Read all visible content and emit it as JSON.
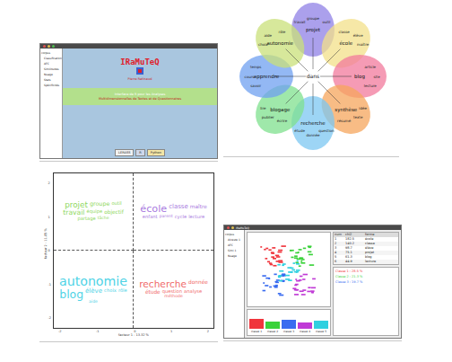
{
  "app_window": {
    "title": "IRaMuTeQ",
    "credit": "Pierre Ratinaud",
    "band_lines": [
      "Interface de R pour les Analyses",
      "Multidimensionnelles de Textes et de Questionnaires"
    ],
    "tree_items": [
      "corpus",
      "Classification",
      "AFC",
      "Similitudes",
      "Nuage",
      "Stats",
      "Spécificités"
    ],
    "logos": [
      "LERASS",
      "R",
      "Python"
    ]
  },
  "similarity_graph": {
    "hub": "dans",
    "clusters": [
      {
        "label": "projet",
        "color": "#8f80e6",
        "words": [
          "travail",
          "groupe",
          "outil"
        ]
      },
      {
        "label": "école",
        "color": "#f3e08a",
        "words": [
          "classe",
          "élève",
          "maître"
        ]
      },
      {
        "label": "blog",
        "color": "#f27a9c",
        "words": [
          "article",
          "site",
          "lecture"
        ]
      },
      {
        "label": "synthèse",
        "color": "#f6a55c",
        "words": [
          "idée",
          "texte",
          "résumé"
        ]
      },
      {
        "label": "recherche",
        "color": "#7cc7f2",
        "words": [
          "question",
          "donnée",
          "étude"
        ]
      },
      {
        "label": "blogage",
        "color": "#7fe08d",
        "words": [
          "écrire",
          "publier",
          "lire"
        ]
      },
      {
        "label": "apprendre",
        "color": "#6fa0f0",
        "words": [
          "savoir",
          "cours",
          "temps"
        ]
      },
      {
        "label": "autonomie",
        "color": "#c9e07a",
        "words": [
          "choix",
          "aide",
          "rôle"
        ]
      }
    ]
  },
  "factor_map": {
    "x_axis": "facteur 1 - 13.32 %",
    "y_axis": "facteur 2 - 11.05 %",
    "x_ticks": [
      "-2",
      "-1",
      "0",
      "1",
      "2"
    ],
    "y_ticks": [
      "2",
      "1",
      "0",
      "-1",
      "-2"
    ],
    "classes": [
      {
        "color": "#8fd860",
        "words": [
          {
            "text": "projet",
            "level": 0.4
          },
          {
            "text": "groupe",
            "level": 0.2
          },
          {
            "text": "outil",
            "level": 0.1
          },
          {
            "text": "travail",
            "level": 0.3
          },
          {
            "text": "équipe",
            "level": 0.1
          },
          {
            "text": "objectif",
            "level": 0.15
          },
          {
            "text": "partage",
            "level": 0.1
          },
          {
            "text": "tâche",
            "level": 0.05
          }
        ]
      },
      {
        "color": "#a97be0",
        "words": [
          {
            "text": "école",
            "level": 0.6
          },
          {
            "text": "classe",
            "level": 0.25
          },
          {
            "text": "maître",
            "level": 0.15
          },
          {
            "text": "enfant",
            "level": 0.1
          },
          {
            "text": "parent",
            "level": 0.05
          },
          {
            "text": "cycle",
            "level": 0.1
          },
          {
            "text": "lecture",
            "level": 0.1
          }
        ]
      },
      {
        "color": "#4fd3e6",
        "words": [
          {
            "text": "autonomie",
            "level": 0.85
          },
          {
            "text": "blog",
            "level": 0.7
          },
          {
            "text": "élève",
            "level": 0.25
          },
          {
            "text": "choix",
            "level": 0.1
          },
          {
            "text": "rôle",
            "level": 0.1
          },
          {
            "text": "aide",
            "level": 0.05
          }
        ]
      },
      {
        "color": "#f06a6a",
        "words": [
          {
            "text": "recherche",
            "level": 0.55
          },
          {
            "text": "donnée",
            "level": 0.15
          },
          {
            "text": "étude",
            "level": 0.15
          },
          {
            "text": "question",
            "level": 0.1
          },
          {
            "text": "analyse",
            "level": 0.1
          },
          {
            "text": "méthode",
            "level": 0.05
          }
        ]
      }
    ]
  },
  "analysis_window": {
    "title": "IRaMuTeQ",
    "tree_items": [
      "corpus",
      "Alceste 1",
      "AFC",
      "Simi 1",
      "Nuage"
    ],
    "table_columns": [
      "num",
      "chi2",
      "forme"
    ],
    "table_rows": [
      [
        "1",
        "182.5",
        "école"
      ],
      [
        "2",
        "140.2",
        "classe"
      ],
      [
        "3",
        "98.7",
        "élève"
      ],
      [
        "4",
        "75.1",
        "projet"
      ],
      [
        "5",
        "61.3",
        "blog"
      ],
      [
        "6",
        "44.9",
        "lecture"
      ]
    ],
    "classes": [
      {
        "label": "classe 1",
        "color": "#f0343c",
        "level": 0.8
      },
      {
        "label": "classe 2",
        "color": "#3ad23a",
        "level": 0.6
      },
      {
        "label": "classe 3",
        "color": "#3a6cf0",
        "level": 0.7
      },
      {
        "label": "classe 4",
        "color": "#c03ad6",
        "level": 0.5
      },
      {
        "label": "classe 5",
        "color": "#30d0e0",
        "level": 0.65
      }
    ],
    "text_lines": [
      "Classe 1 : 28.5 %",
      "Classe 2 : 21.3 %",
      "Classe 3 : 19.7 %"
    ]
  }
}
